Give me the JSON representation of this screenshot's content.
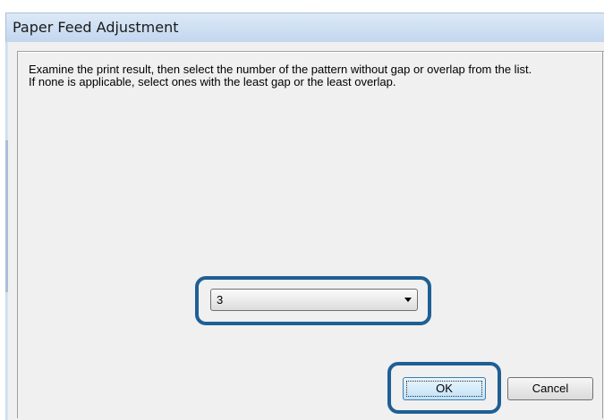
{
  "window": {
    "title": "Paper Feed Adjustment"
  },
  "instructions": {
    "line1": "Examine the print result, then select the number of the pattern without gap or overlap from the list.",
    "line2": "If none is applicable, select ones with the least gap or the least overlap."
  },
  "pattern_select": {
    "value": "3",
    "icon": "chevron-down-icon"
  },
  "buttons": {
    "ok_label": "OK",
    "cancel_label": "Cancel"
  },
  "colors": {
    "highlight": "#1f5f95",
    "titlebar": "#cfe0f3",
    "client_background": "#f0f0f0"
  }
}
